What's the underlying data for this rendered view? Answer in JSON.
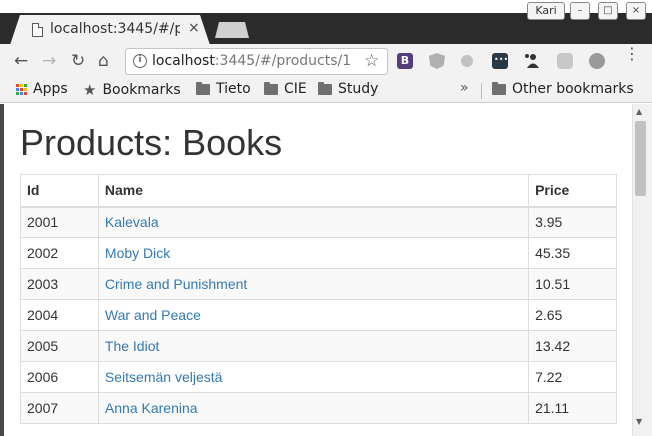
{
  "browser": {
    "tab": {
      "title_main": "localhost:3445/#/p",
      "close_glyph": "×"
    },
    "profile_name": "Kari",
    "window_controls": [
      "–",
      "□",
      "×"
    ],
    "nav": {
      "back": "←",
      "forward": "→",
      "reload": "↻",
      "home": "⌂"
    },
    "address": {
      "host": "localhost",
      "rest": ":3445/#/products/1",
      "info_glyph": "i"
    },
    "star_glyph": "☆",
    "extensions": [
      {
        "name": "bootstrap-icon",
        "glyph": "B"
      },
      {
        "name": "angular-icon"
      },
      {
        "name": "lightbulb-icon"
      },
      {
        "name": "dots-extension-icon"
      },
      {
        "name": "person-extension-icon"
      },
      {
        "name": "chat-extension-icon"
      },
      {
        "name": "balloon-extension-icon"
      }
    ],
    "menu_glyph": "⋮",
    "bookmarks": {
      "apps": "Apps",
      "bookmarks": "Bookmarks",
      "folders": [
        "Tieto",
        "CIE",
        "Study"
      ],
      "overflow": "»",
      "other": "Other bookmarks"
    },
    "apps_grid_colors": [
      "#ea4335",
      "#fbbc05",
      "#34a853",
      "#4285f4",
      "#ea4335",
      "#fbbc05",
      "#34a853",
      "#4285f4",
      "#ea4335"
    ]
  },
  "page": {
    "title": "Products: Books",
    "columns": [
      "Id",
      "Name",
      "Price"
    ],
    "rows": [
      {
        "id": "2001",
        "name": "Kalevala",
        "price": "3.95"
      },
      {
        "id": "2002",
        "name": "Moby Dick",
        "price": "45.35"
      },
      {
        "id": "2003",
        "name": "Crime and Punishment",
        "price": "10.51"
      },
      {
        "id": "2004",
        "name": "War and Peace",
        "price": "2.65"
      },
      {
        "id": "2005",
        "name": "The Idiot",
        "price": "13.42"
      },
      {
        "id": "2006",
        "name": "Seitsemän veljestä",
        "price": "7.22"
      },
      {
        "id": "2007",
        "name": "Anna Karenina",
        "price": "21.11"
      }
    ]
  },
  "colors": {
    "link": "#337ab7",
    "bootstrap": "#563d7c"
  }
}
